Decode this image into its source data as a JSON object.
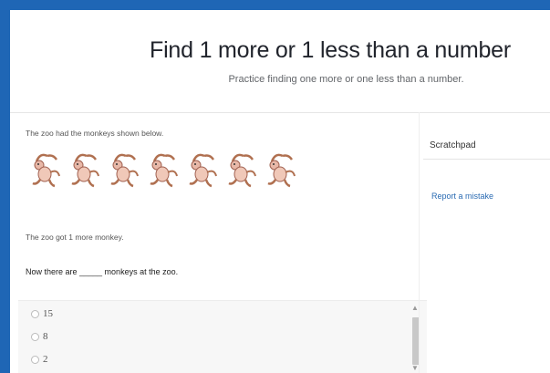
{
  "header": {
    "title": "Find 1 more or 1 less than a number",
    "subtitle": "Practice finding one more or one less than a number."
  },
  "question": {
    "line1": "The zoo had the monkeys shown below.",
    "monkey_count": 7,
    "line2": "The zoo got 1 more monkey.",
    "line3": "Now there are _____ monkeys at the zoo."
  },
  "answers": {
    "choices": [
      "15",
      "8",
      "2"
    ]
  },
  "sidebar": {
    "scratchpad_label": "Scratchpad",
    "report_label": "Report a mistake"
  },
  "colors": {
    "frame_border": "#1f66b5",
    "link": "#2a6bb3"
  }
}
